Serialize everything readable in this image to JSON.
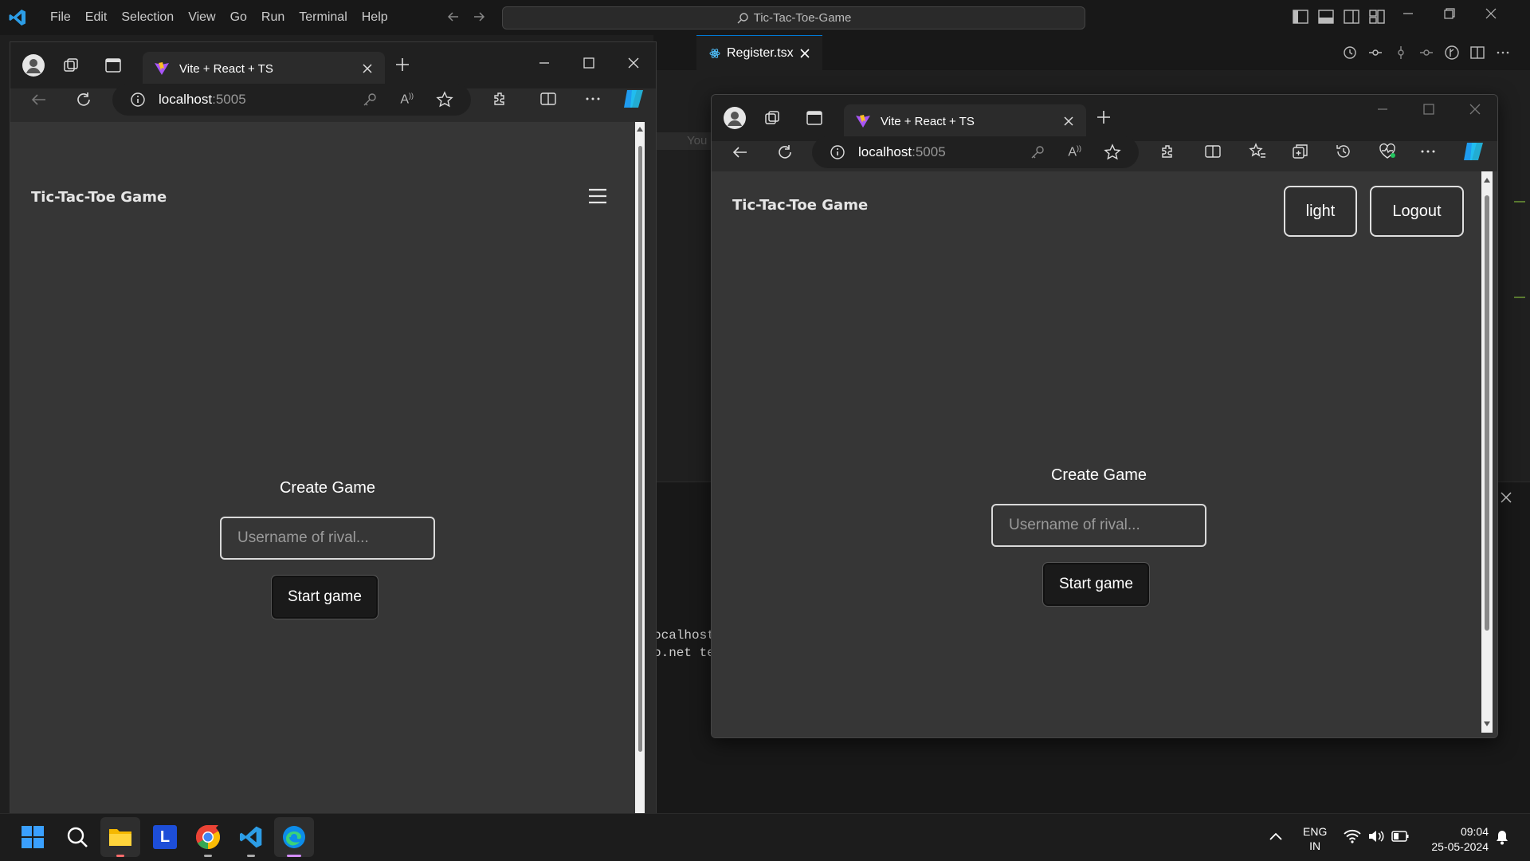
{
  "vscode": {
    "menu": [
      "File",
      "Edit",
      "Selection",
      "View",
      "Go",
      "Run",
      "Terminal",
      "Help"
    ],
    "command_center": "Tic-Tac-Toe-Game",
    "tab_label": "Register.tsx",
    "ghost_text": "You",
    "terminal_lines": [
      "ocalhost",
      "o.net te"
    ],
    "accent": "#0078d4"
  },
  "browser_left": {
    "tab_title": "Vite + React + TS",
    "url_host": "localhost",
    "url_port": ":5005",
    "app": {
      "title": "Tic-Tac-Toe Game",
      "create_heading": "Create Game",
      "rival_placeholder": "Username of rival...",
      "start_label": "Start game"
    }
  },
  "browser_right": {
    "tab_title": "Vite + React + TS",
    "url_host": "localhost",
    "url_port": ":5005",
    "app": {
      "title": "Tic-Tac-Toe Game",
      "theme_button": "light",
      "logout_button": "Logout",
      "create_heading": "Create Game",
      "rival_placeholder": "Username of rival...",
      "start_label": "Start game"
    }
  },
  "taskbar": {
    "apps": [
      "windows-start",
      "search",
      "file-explorer",
      "l-app",
      "chrome",
      "vscode",
      "edge"
    ],
    "lang": "ENG",
    "region": "IN",
    "time": "09:04",
    "date": "25-05-2024"
  }
}
